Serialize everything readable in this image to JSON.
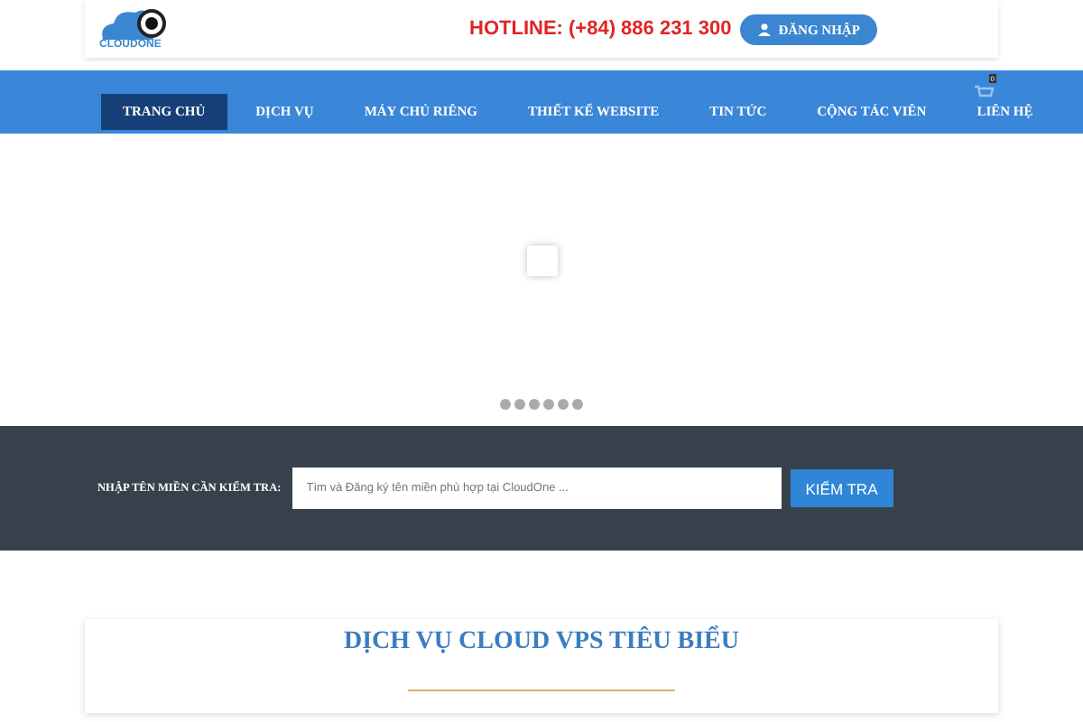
{
  "header": {
    "logo_text": "CLOUDONE",
    "hotline": "HOTLINE: (+84) 886 231 300",
    "login_button": "ĐĂNG NHẬP"
  },
  "nav": {
    "items": [
      {
        "label": "TRANG CHỦ",
        "selected": true
      },
      {
        "label": "DỊCH VỤ",
        "selected": false
      },
      {
        "label": "MÁY CHỦ RIÊNG",
        "selected": false
      },
      {
        "label": "THIẾT KẾ WEBSITE",
        "selected": false
      },
      {
        "label": "TIN TỨC",
        "selected": false
      },
      {
        "label": "CỘNG TÁC VIÊN",
        "selected": false
      },
      {
        "label": "LIÊN HỆ",
        "selected": false
      }
    ],
    "cart_count": "0"
  },
  "slider": {
    "dots": [
      {
        "selected": false
      },
      {
        "selected": false
      },
      {
        "selected": false
      },
      {
        "selected": false
      },
      {
        "selected": false
      },
      {
        "selected": false
      }
    ]
  },
  "domain_search": {
    "label": "NHẬP TÊN MIỀN CẦN KIỂM TRA:",
    "placeholder": "Tìm và Đăng ký tên miền phù hợp tại CloudOne ...",
    "button": "KIỂM TRA"
  },
  "section": {
    "title": "DỊCH VỤ CLOUD VPS TIÊU BIỂU"
  }
}
